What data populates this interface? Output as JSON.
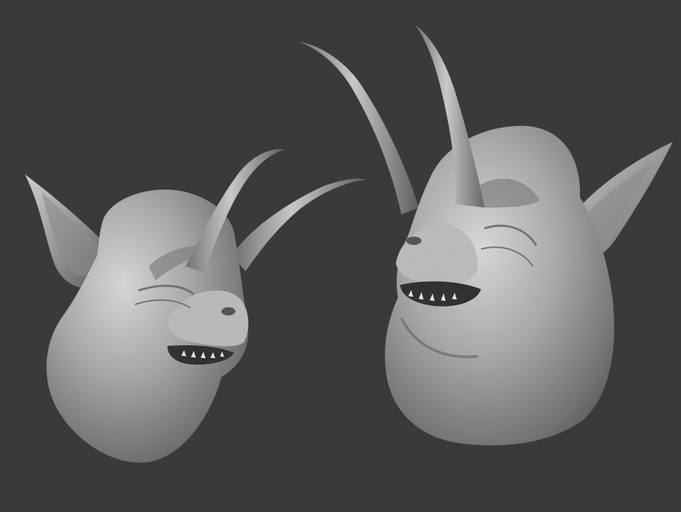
{
  "scene": {
    "background_color": "#3a3a3c",
    "sculpt_color": "#9a9a9c",
    "sculpt_highlight": "#d6d6d8",
    "sculpt_shadow": "#4a4a4c",
    "subjects": [
      {
        "name": "creature-head-left",
        "features": [
          "pointed-ear",
          "two-curved-horns",
          "open-mouth-with-teeth",
          "bulbous-throat"
        ]
      },
      {
        "name": "creature-head-right",
        "features": [
          "pointed-ear",
          "two-long-horns",
          "open-mouth-with-teeth",
          "bulbous-throat"
        ]
      }
    ]
  }
}
